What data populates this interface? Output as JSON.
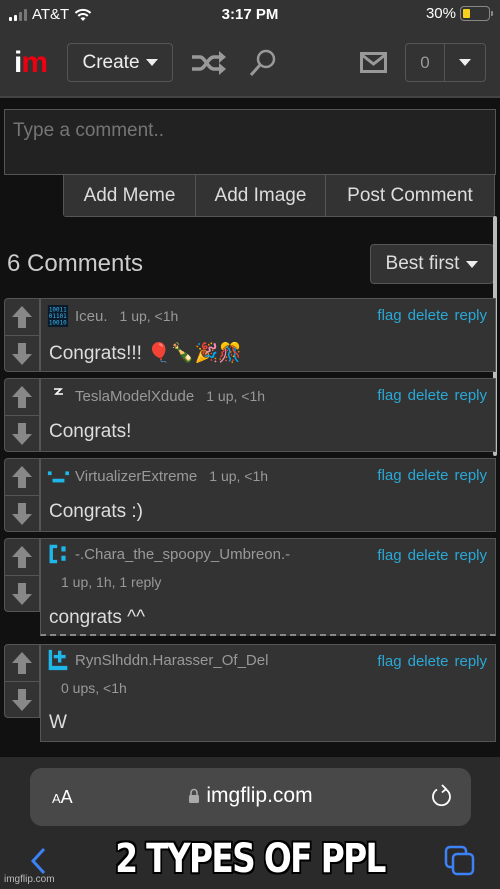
{
  "status_bar": {
    "carrier": "AT&T",
    "time": "3:17 PM",
    "battery_percent": "30%",
    "battery_level": 0.3,
    "signal_bars_active": 2,
    "signal_bars_total": 4
  },
  "header": {
    "logo_i": "i",
    "logo_m": "m",
    "create_label": "Create",
    "icons": [
      "shuffle-icon",
      "search-icon",
      "mail-icon"
    ],
    "notification_count": "0"
  },
  "composer": {
    "placeholder": "Type a comment..",
    "value": "",
    "buttons": [
      "Add Meme",
      "Add Image",
      "Post Comment"
    ]
  },
  "comments_section": {
    "title": "6 Comments",
    "sort_label": "Best first",
    "action_labels": {
      "flag": "flag",
      "delete": "delete",
      "reply": "reply"
    },
    "comments": [
      {
        "username": "Iceu.",
        "stats": "1 up, <1h",
        "text": "Congrats!!! 🎈🍾🎉🎊",
        "avatar": "binary-avatar"
      },
      {
        "username": "TeslaModelXdude",
        "stats": "1 up, <1h",
        "text": "Congrats!",
        "avatar": "bolt-avatar"
      },
      {
        "username": "VirtualizerExtreme",
        "stats": "1 up, <1h",
        "text": "Congrats :)",
        "avatar": "face-avatar"
      },
      {
        "username": "-.Chara_the_spoopy_Umbreon.-",
        "stats": "1 up, 1h, 1 reply",
        "text": "congrats ^^",
        "avatar": "bracket-avatar"
      },
      {
        "username": "RynSlhddn.Harasser_Of_Del",
        "stats": "0 ups, <1h",
        "text": "W",
        "avatar": "plus-avatar"
      }
    ]
  },
  "browser": {
    "text_size_label_small": "A",
    "text_size_label_large": "A",
    "url": "imgflip.com"
  },
  "meme_caption": "2 TYPES OF PPL",
  "watermark": "imgflip.com",
  "colors": {
    "link": "#2aa8d6",
    "logo_red": "#ee1111",
    "avatar_blue": "#1fb6ea",
    "browser_accent": "#3b82f6"
  }
}
